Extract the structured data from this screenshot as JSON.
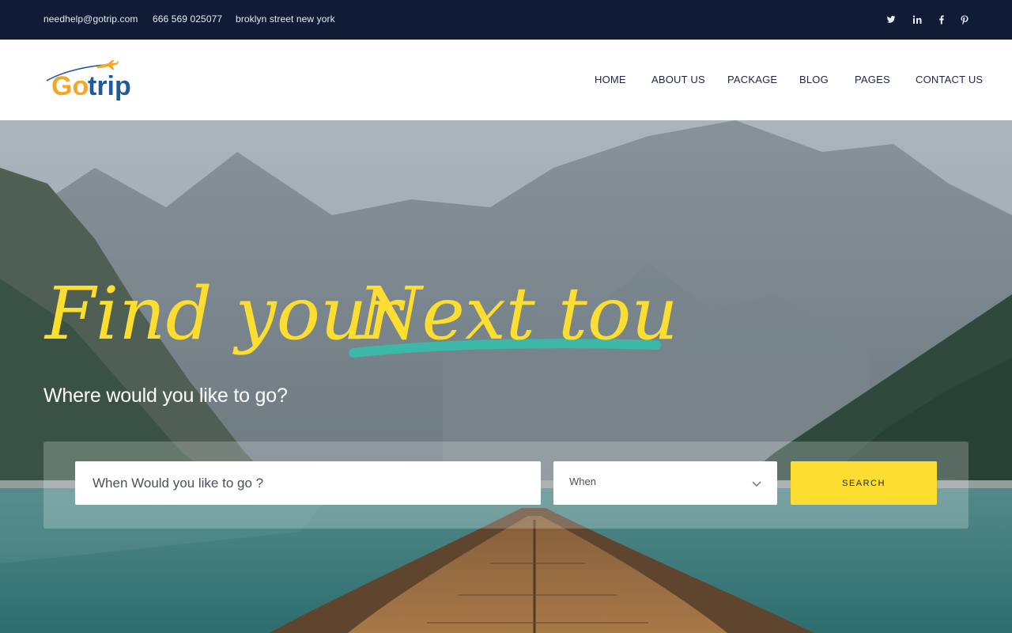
{
  "topbar": {
    "email": "needhelp@gotrip.com",
    "phone": "666 569 025077",
    "address": "broklyn street new york",
    "social": [
      "twitter-icon",
      "linkedin-icon",
      "facebook-icon",
      "pinterest-icon"
    ]
  },
  "logo": {
    "go": "Go",
    "trip": "trip"
  },
  "nav": {
    "home": "HOME",
    "about": "ABOUT US",
    "package": "PACKAGE",
    "blog": "BLOG",
    "pages": "PAGES",
    "contact": "CONTACT US"
  },
  "hero": {
    "title_part1": "Find your",
    "title_part2": "Next tour!",
    "subtitle": "Where would you like to go?"
  },
  "search": {
    "where_placeholder": "When Would you like to go ?",
    "when_value": "When",
    "button_label": "SEARCH"
  },
  "colors": {
    "topbar_bg": "#101b36",
    "nav_text": "#1b2745",
    "accent_yellow": "#fddd2f",
    "accent_teal": "#3bb8a8",
    "logo_blue": "#1f5b9c",
    "logo_orange": "#f5a623"
  }
}
